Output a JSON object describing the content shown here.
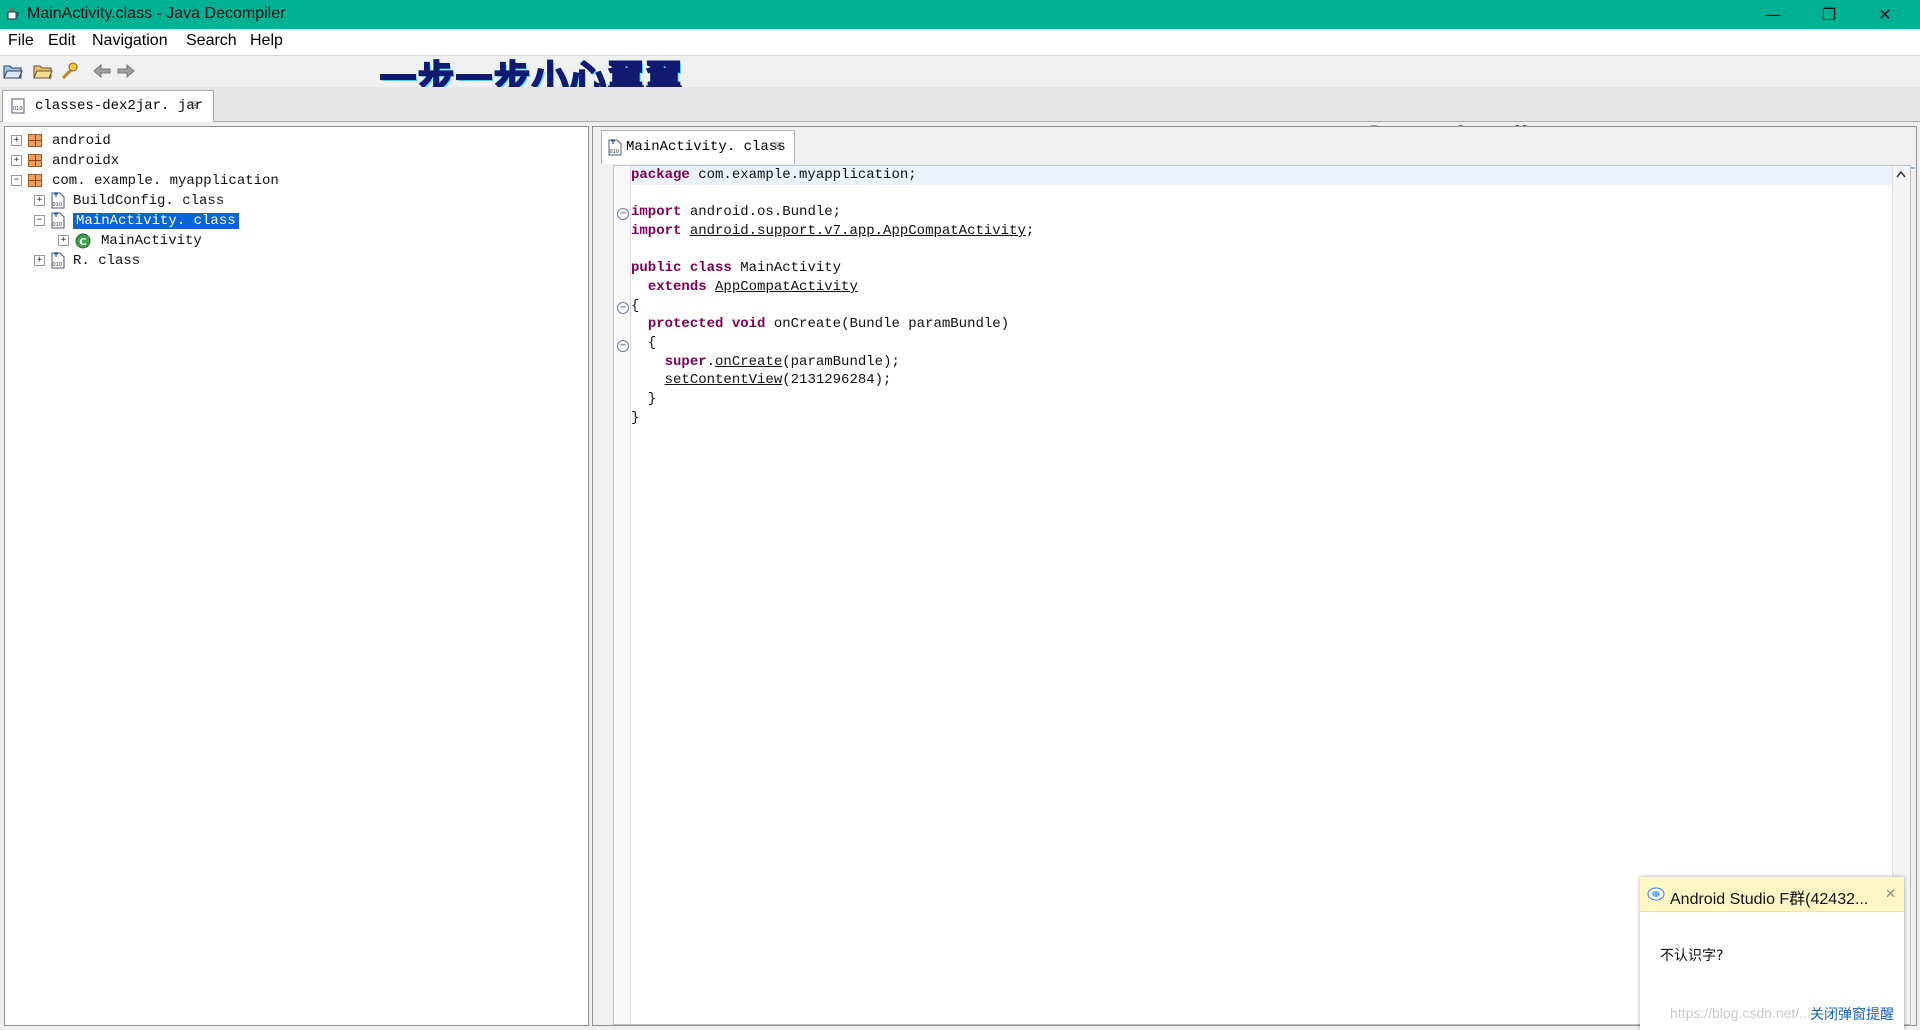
{
  "window": {
    "title": "MainActivity.class - Java Decompiler",
    "controls": {
      "minimize": "—",
      "restore": "❐",
      "close": "✕"
    }
  },
  "menubar": {
    "items": [
      {
        "label": "File"
      },
      {
        "label": "Edit"
      },
      {
        "label": "Navigation"
      },
      {
        "label": "Search"
      },
      {
        "label": "Help"
      }
    ]
  },
  "toolbar": {
    "buttons": [
      "open-file-icon",
      "open-folder-icon",
      "open-type-icon",
      "back-arrow-icon",
      "forward-arrow-icon"
    ]
  },
  "overlays": {
    "top": "一步一步小心翼翼",
    "right": "一不小心丢了你"
  },
  "outer_tab": {
    "label": "classes-dex2jar. jar",
    "close": "☒"
  },
  "tree": {
    "items": [
      {
        "label": "android",
        "type": "package",
        "expander": "+"
      },
      {
        "label": "androidx",
        "type": "package",
        "expander": "+"
      },
      {
        "label": "com. example. myapplication",
        "type": "package",
        "expander": "−"
      },
      {
        "label": "BuildConfig. class",
        "type": "class-file",
        "expander": "+"
      },
      {
        "label": "MainActivity. class",
        "type": "class-file",
        "expander": "−",
        "selected": true
      },
      {
        "label": "MainActivity",
        "type": "class",
        "expander": "+"
      },
      {
        "label": "R. class",
        "type": "class-file",
        "expander": "+"
      }
    ]
  },
  "inner_tab": {
    "label": "MainActivity. class",
    "close": "☒"
  },
  "code": {
    "l1_kw": "package",
    "l1_rest": " com.example.myapplication;",
    "l2_kw": "import",
    "l2_rest": " android.os.Bundle;",
    "l3_kw": "import",
    "l3_sp": " ",
    "l3_link": "android.support.v7.app.AppCompatActivity",
    "l3_end": ";",
    "l4_kw1": "public",
    "l4_sp": " ",
    "l4_kw2": "class",
    "l4_rest": " MainActivity",
    "l5_indent": "  ",
    "l5_kw": "extends",
    "l5_sp": " ",
    "l5_link": "AppCompatActivity",
    "l6": "{",
    "l7_indent": "  ",
    "l7_kw1": "protected",
    "l7_sp": " ",
    "l7_kw2": "void",
    "l7_rest": " onCreate(Bundle paramBundle)",
    "l8": "  {",
    "l9_indent": "    ",
    "l9_kw": "super",
    "l9_dot": ".",
    "l9_link": "onCreate",
    "l9_rest": "(paramBundle);",
    "l10_indent": "    ",
    "l10_link": "setContentView",
    "l10_rest": "(2131296284);",
    "l11": "  }",
    "l12": "}",
    "fold_symbol": "−"
  },
  "popup": {
    "title": "Android Studio F群(42432...",
    "close": "✕",
    "message": "不认识字?",
    "link": "关闭弹窗提醒"
  },
  "watermark": "https://blog.csdn.net/..."
}
